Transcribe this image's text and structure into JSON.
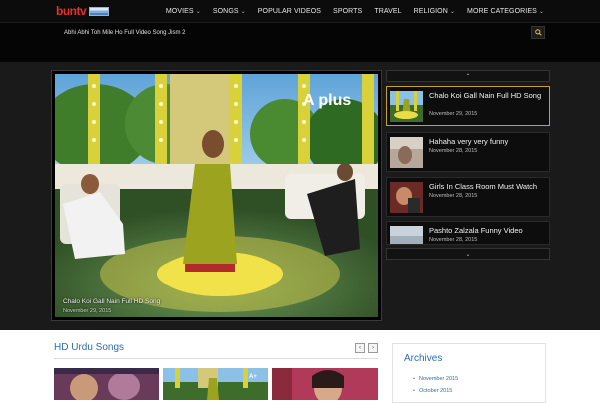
{
  "site": {
    "logo_text_a": "bun",
    "logo_text_b": "tv"
  },
  "nav": [
    {
      "label": "MOVIES",
      "dropdown": true
    },
    {
      "label": "SONGS",
      "dropdown": true
    },
    {
      "label": "POPULAR VIDEOS",
      "dropdown": false
    },
    {
      "label": "SPORTS",
      "dropdown": false
    },
    {
      "label": "TRAVEL",
      "dropdown": false
    },
    {
      "label": "RELIGION",
      "dropdown": true
    },
    {
      "label": "MORE CATEGORIES",
      "dropdown": true
    }
  ],
  "ticker": {
    "text": "Abhi Abhi Toh Mile Ho Full Video Song Jism 2"
  },
  "player": {
    "title": "Chalo Koi Gall Nain Full HD Song",
    "date": "November 29, 2015",
    "channel_logo": "A plus"
  },
  "side_list": [
    {
      "title": "Chalo Koi Gall Nain Full HD Song",
      "date": "November 29, 2015",
      "active": true
    },
    {
      "title": "Hahaha very very funny",
      "date": "November 28, 2015",
      "active": false
    },
    {
      "title": "Girls In Class Room Must Watch",
      "date": "November 28, 2015",
      "active": false
    },
    {
      "title": "Pashto Zalzala Funny Video",
      "date": "November 28, 2015",
      "active": false
    }
  ],
  "section": {
    "title": "HD Urdu Songs"
  },
  "archives": {
    "title": "Archives",
    "items": [
      "November 2015",
      "October 2015"
    ]
  },
  "colors": {
    "accent_blue": "#2a6fb3",
    "active_border": "#c9a227",
    "logo_red": "#e53030"
  }
}
